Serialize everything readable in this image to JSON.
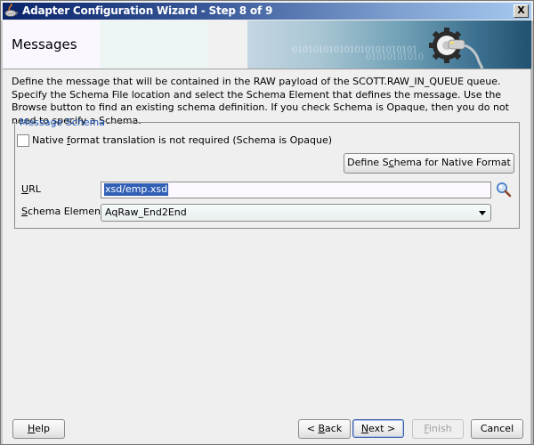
{
  "window": {
    "title": "Adapter Configuration Wizard - Step 8 of 9",
    "close_label": "X"
  },
  "header": {
    "page_title": "Messages",
    "banner_binary_1": "010101010101010101010101",
    "banner_binary_2": "01010101010"
  },
  "description": "Define the message that will be contained in the RAW payload of the SCOTT.RAW_IN_QUEUE queue.  Specify the Schema File location and select the Schema Element that defines the message. Use the Browse button to find an existing schema definition. If you check Schema is Opaque, then you do not need to specify a Schema.",
  "message_schema": {
    "legend": "Message Schema",
    "opaque_checkbox": {
      "label_pre": "Native ",
      "label_mnemonic": "f",
      "label_post": "ormat translation is not required (Schema is Opaque)",
      "checked": false
    },
    "define_button": {
      "pre": "Define S",
      "mnemonic": "c",
      "post": "hema for Native Format"
    },
    "url": {
      "label_mnemonic": "U",
      "label_post": "RL",
      "value": "xsd/emp.xsd"
    },
    "schema_element": {
      "label_mnemonic": "S",
      "label_post": "chema Element",
      "value": "AqRaw_End2End"
    }
  },
  "footer": {
    "help": {
      "mnemonic": "H",
      "post": "elp"
    },
    "back": {
      "pre": "< ",
      "mnemonic": "B",
      "post": "ack"
    },
    "next": {
      "mnemonic": "N",
      "post": "ext >"
    },
    "finish": {
      "mnemonic": "F",
      "post": "inish",
      "enabled": false
    },
    "cancel": {
      "label": "Cancel"
    }
  }
}
